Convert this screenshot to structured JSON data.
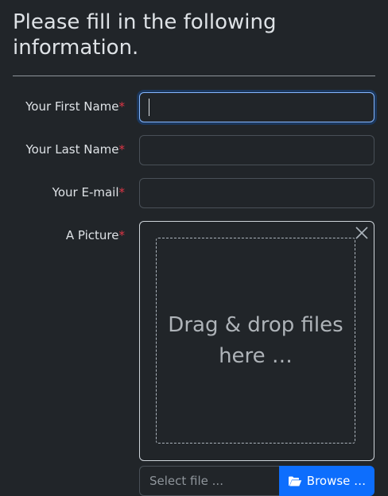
{
  "form": {
    "heading": "Please fill in the following information.",
    "required_marker": "*",
    "fields": {
      "first_name": {
        "label": "Your First Name",
        "value": ""
      },
      "last_name": {
        "label": "Your Last Name",
        "value": ""
      },
      "email": {
        "label": "Your E-mail",
        "value": ""
      },
      "picture": {
        "label": "A Picture"
      }
    },
    "dropzone": {
      "text": "Drag & drop files here …"
    },
    "file_input": {
      "caption": "Select file ...",
      "browse_label": "Browse …"
    }
  },
  "colors": {
    "background": "#212529",
    "text": "#dee2e6",
    "required": "#dc3545",
    "accent": "#0d6efd",
    "focus_border": "#86b7fe"
  },
  "icons": {
    "dropzone_close": "close-icon",
    "browse": "folder-open-icon"
  }
}
